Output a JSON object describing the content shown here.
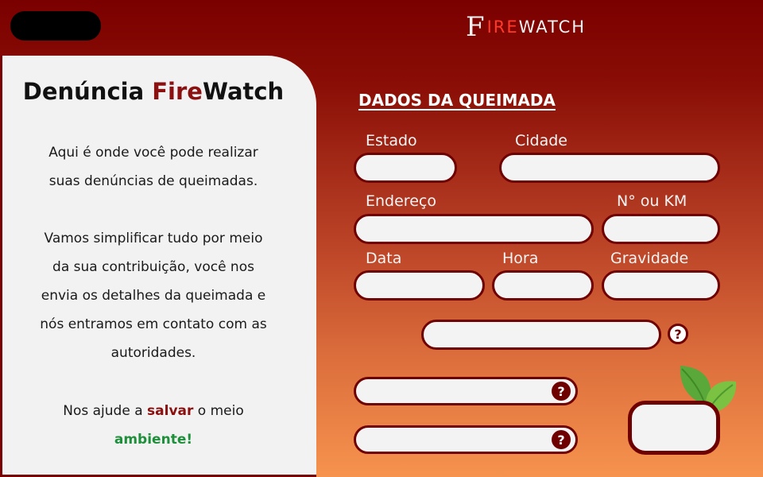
{
  "header": {
    "logo_f": "F",
    "logo_ire": "IRE",
    "logo_watch": "WATCH"
  },
  "sidebar": {
    "title_part1": "Denúncia ",
    "title_accent": "Fire",
    "title_part2": "Watch",
    "intro_line1": "Aqui é onde você pode realizar",
    "intro_line2": "suas denúncias de queimadas.",
    "body_line1": "Vamos simplificar tudo por meio",
    "body_line2": "da sua contribuição, você nos",
    "body_line3": "envia os detalhes da queimada e",
    "body_line4": "nós entramos em contato com as",
    "body_line5": "autoridades.",
    "cta_pre": "Nos ajude a ",
    "cta_red": "salvar",
    "cta_post": " o meio",
    "cta_green": "ambiente!"
  },
  "form": {
    "section_title": "DADOS DA QUEIMADA",
    "labels": {
      "estado": "Estado",
      "cidade": "Cidade",
      "endereco": "Endereço",
      "numero": "N° ou KM",
      "data": "Data",
      "hora": "Hora",
      "gravidade": "Gravidade"
    },
    "help_glyph": "?"
  },
  "colors": {
    "brand_dark_red": "#7a0000",
    "accent_red": "#8b1111",
    "accent_green": "#1e8f3a",
    "gradient_bottom": "#f6934e"
  },
  "icons": [
    "help-icon",
    "leaf-icon"
  ]
}
